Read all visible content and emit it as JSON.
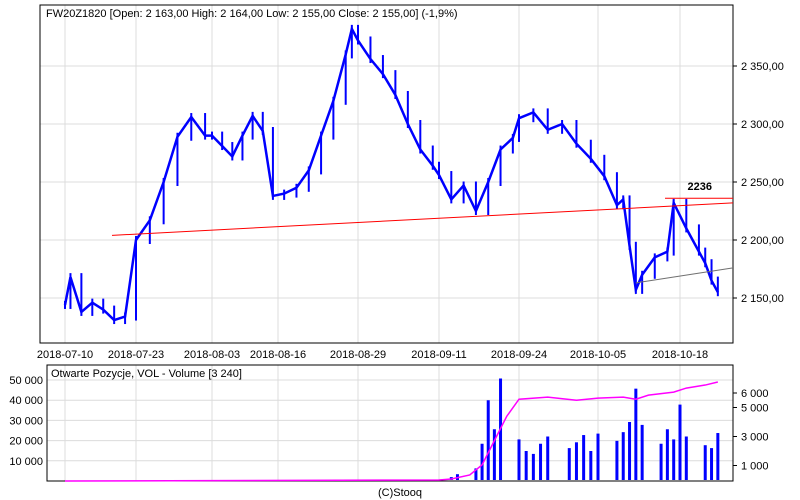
{
  "chart_data": [
    {
      "type": "line",
      "title": "FW20Z1820 [Open: 2 163,00  High: 2 164,00  Low: 2 155,00  Close: 2 155,00] (-1,9%)",
      "x_ticks": [
        "2018-07-10",
        "2018-07-23",
        "2018-08-03",
        "2018-08-16",
        "2018-08-29",
        "2018-09-11",
        "2018-09-24",
        "2018-10-05",
        "2018-10-18"
      ],
      "y_ticks": [
        2150,
        2200,
        2250,
        2300,
        2350
      ],
      "y_tick_labels": [
        "2 150,00",
        "2 200,00",
        "2 250,00",
        "2 300,00",
        "2 350,00"
      ],
      "ylim": [
        2125,
        2392
      ],
      "y_axis_side": "right",
      "grid": true,
      "series_color": "#0000ff",
      "points": [
        [
          "2018-07-10",
          2144
        ],
        [
          "2018-07-11",
          2168
        ],
        [
          "2018-07-13",
          2138
        ],
        [
          "2018-07-15",
          2146
        ],
        [
          "2018-07-17",
          2140
        ],
        [
          "2018-07-19",
          2131
        ],
        [
          "2018-07-21",
          2134
        ],
        [
          "2018-07-23",
          2200
        ],
        [
          "2018-07-25",
          2217
        ],
        [
          "2018-07-27",
          2250
        ],
        [
          "2018-07-29",
          2289
        ],
        [
          "2018-07-31",
          2306
        ],
        [
          "2018-08-02",
          2290
        ],
        [
          "2018-08-03",
          2290
        ],
        [
          "2018-08-05",
          2281
        ],
        [
          "2018-08-07",
          2272
        ],
        [
          "2018-08-09",
          2290
        ],
        [
          "2018-08-11",
          2307
        ],
        [
          "2018-08-13",
          2294
        ],
        [
          "2018-08-15",
          2238
        ],
        [
          "2018-08-17",
          2240
        ],
        [
          "2018-08-19",
          2245
        ],
        [
          "2018-08-21",
          2260
        ],
        [
          "2018-08-23",
          2290
        ],
        [
          "2018-08-25",
          2320
        ],
        [
          "2018-08-27",
          2360
        ],
        [
          "2018-08-28",
          2382
        ],
        [
          "2018-08-29",
          2372
        ],
        [
          "2018-08-31",
          2356
        ],
        [
          "2018-09-02",
          2343
        ],
        [
          "2018-09-04",
          2325
        ],
        [
          "2018-09-06",
          2300
        ],
        [
          "2018-09-08",
          2278
        ],
        [
          "2018-09-10",
          2264
        ],
        [
          "2018-09-11",
          2256
        ],
        [
          "2018-09-13",
          2235
        ],
        [
          "2018-09-15",
          2247
        ],
        [
          "2018-09-17",
          2225
        ],
        [
          "2018-09-19",
          2250
        ],
        [
          "2018-09-21",
          2278
        ],
        [
          "2018-09-23",
          2288
        ],
        [
          "2018-09-24",
          2305
        ],
        [
          "2018-09-26",
          2310
        ],
        [
          "2018-09-28",
          2295
        ],
        [
          "2018-09-30",
          2300
        ],
        [
          "2018-10-02",
          2283
        ],
        [
          "2018-10-04",
          2270
        ],
        [
          "2018-10-06",
          2255
        ],
        [
          "2018-10-08",
          2230
        ],
        [
          "2018-10-09",
          2235
        ],
        [
          "2018-10-10",
          2195
        ],
        [
          "2018-10-11",
          2157
        ],
        [
          "2018-10-12",
          2170
        ],
        [
          "2018-10-14",
          2185
        ],
        [
          "2018-10-16",
          2190
        ],
        [
          "2018-10-17",
          2232
        ],
        [
          "2018-10-19",
          2210
        ],
        [
          "2018-10-21",
          2190
        ],
        [
          "2018-10-22",
          2180
        ],
        [
          "2018-10-23",
          2165
        ],
        [
          "2018-10-24",
          2155
        ]
      ],
      "annotations": {
        "level_label": "2236",
        "level_value": 2236,
        "level_color": "#ff0000",
        "trendline_red": [
          [
            "2018-07-18",
            2204
          ],
          [
            "2018-10-26",
            2232
          ]
        ],
        "trendline_gray": [
          [
            "2018-10-11",
            2163
          ],
          [
            "2018-10-26",
            2176
          ]
        ]
      }
    },
    {
      "type": "bar",
      "title": "Otwarte Pozycje, VOL - Volume [3 240]",
      "left_axis_ticks": [
        10000,
        20000,
        30000,
        40000,
        50000
      ],
      "left_axis_labels": [
        "10 000",
        "20 000",
        "30 000",
        "40 000",
        "50 000"
      ],
      "right_axis_ticks": [
        1000,
        3000,
        5000,
        6000
      ],
      "right_axis_labels": [
        "1 000",
        "3 000",
        "5 000",
        "6 000"
      ],
      "open_interest_color": "#ff00ff",
      "volume_color": "#0000ff",
      "open_interest": [
        [
          "2018-07-10",
          0
        ],
        [
          "2018-08-03",
          200
        ],
        [
          "2018-09-11",
          500
        ],
        [
          "2018-09-13",
          1000
        ],
        [
          "2018-09-16",
          3000
        ],
        [
          "2018-09-18",
          8000
        ],
        [
          "2018-09-20",
          20000
        ],
        [
          "2018-09-22",
          32000
        ],
        [
          "2018-09-24",
          40500
        ],
        [
          "2018-09-28",
          41500
        ],
        [
          "2018-10-02",
          40000
        ],
        [
          "2018-10-05",
          41000
        ],
        [
          "2018-10-09",
          41500
        ],
        [
          "2018-10-11",
          40500
        ],
        [
          "2018-10-13",
          42500
        ],
        [
          "2018-10-17",
          44000
        ],
        [
          "2018-10-19",
          46000
        ],
        [
          "2018-10-22",
          47500
        ],
        [
          "2018-10-24",
          49000
        ]
      ],
      "volume": [
        [
          "2018-09-13",
          200
        ],
        [
          "2018-09-14",
          400
        ],
        [
          "2018-09-17",
          800
        ],
        [
          "2018-09-18",
          2500
        ],
        [
          "2018-09-19",
          5500
        ],
        [
          "2018-09-20",
          3500
        ],
        [
          "2018-09-21",
          7000
        ],
        [
          "2018-09-24",
          2800
        ],
        [
          "2018-09-25",
          2000
        ],
        [
          "2018-09-26",
          1800
        ],
        [
          "2018-09-27",
          2500
        ],
        [
          "2018-09-28",
          3000
        ],
        [
          "2018-10-01",
          2200
        ],
        [
          "2018-10-02",
          2600
        ],
        [
          "2018-10-03",
          3100
        ],
        [
          "2018-10-04",
          2000
        ],
        [
          "2018-10-05",
          3200
        ],
        [
          "2018-10-08",
          2700
        ],
        [
          "2018-10-09",
          3300
        ],
        [
          "2018-10-10",
          4000
        ],
        [
          "2018-10-11",
          6300
        ],
        [
          "2018-10-12",
          3800
        ],
        [
          "2018-10-15",
          2500
        ],
        [
          "2018-10-16",
          3500
        ],
        [
          "2018-10-17",
          2800
        ],
        [
          "2018-10-18",
          5200
        ],
        [
          "2018-10-19",
          3000
        ],
        [
          "2018-10-22",
          2400
        ],
        [
          "2018-10-23",
          2200
        ],
        [
          "2018-10-24",
          3240
        ]
      ]
    }
  ],
  "footer": {
    "credit": "(C)Stooq"
  }
}
